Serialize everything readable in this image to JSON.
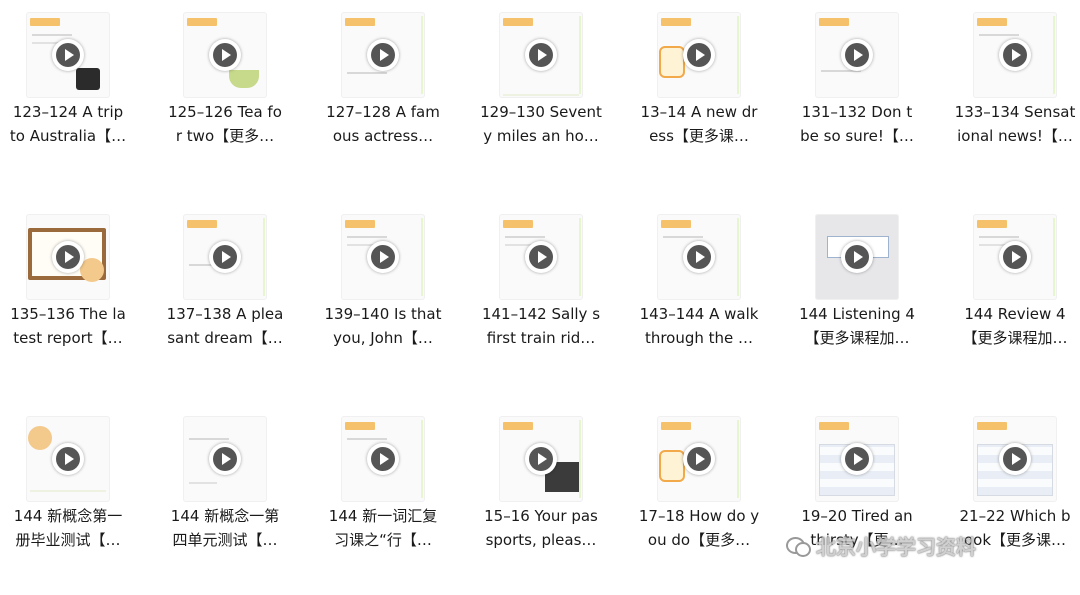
{
  "tiles": [
    {
      "line1": "123–124 A trip",
      "line2": "to Australia【…"
    },
    {
      "line1": "125–126 Tea fo",
      "line2": "r two【更多…"
    },
    {
      "line1": "127–128 A fam",
      "line2": "ous actress…"
    },
    {
      "line1": "129–130 Sevent",
      "line2": "y miles an ho…"
    },
    {
      "line1": "13–14 A new dr",
      "line2": "ess【更多课…"
    },
    {
      "line1": "131–132 Don t",
      "line2": "be so sure!【…"
    },
    {
      "line1": "133–134 Sensat",
      "line2": "ional news!【…"
    },
    {
      "line1": "135–136 The la",
      "line2": "test report【…"
    },
    {
      "line1": "137–138 A plea",
      "line2": "sant dream【…"
    },
    {
      "line1": "139–140 Is that",
      "line2": "you, John【…"
    },
    {
      "line1": "141–142 Sally s",
      "line2": "first train rid…"
    },
    {
      "line1": "143–144 A walk",
      "line2": "through the …"
    },
    {
      "line1": "144 Listening 4",
      "line2": "【更多课程加…"
    },
    {
      "line1": "144 Review 4",
      "line2": "【更多课程加…"
    },
    {
      "line1": "144 新概念第一",
      "line2": "册毕业测试【…"
    },
    {
      "line1": "144 新概念一第",
      "line2": "四单元测试【…"
    },
    {
      "line1": "144 新一词汇复",
      "line2": "习课之“行【…"
    },
    {
      "line1": "15–16 Your pas",
      "line2": "sports, pleas…"
    },
    {
      "line1": "17–18 How do y",
      "line2": "ou do【更多…"
    },
    {
      "line1": "19–20 Tired an",
      "line2": "thirsty【更…"
    },
    {
      "line1": "21–22 Which b",
      "line2": "ook【更多课…"
    }
  ],
  "watermark": {
    "text": "北京小学学习资料",
    "icon": "wechat-icon"
  }
}
